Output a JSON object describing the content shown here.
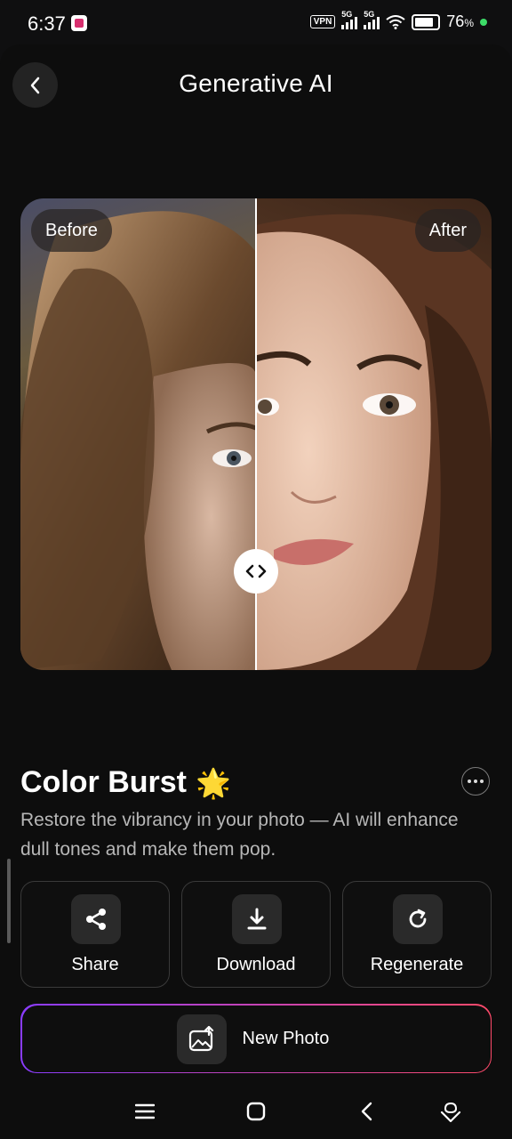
{
  "status_bar": {
    "time": "6:37",
    "vpn": "VPN",
    "network_1": "5G",
    "network_2": "5G",
    "battery_pct": "76",
    "battery_unit": "%"
  },
  "header": {
    "title": "Generative AI",
    "back_icon": "chevron-left-icon"
  },
  "compare": {
    "before_label": "Before",
    "after_label": "After",
    "handle_icon": "compare-arrows-icon"
  },
  "effect": {
    "title": "Color Burst",
    "emoji": "🌟",
    "description": "Restore the vibrancy in your photo — AI will enhance dull tones and make them pop."
  },
  "actions": [
    {
      "label": "Share",
      "icon": "share-icon"
    },
    {
      "label": "Download",
      "icon": "download-icon"
    },
    {
      "label": "Regenerate",
      "icon": "refresh-icon"
    }
  ],
  "new_photo": {
    "label": "New Photo",
    "icon": "image-upload-icon"
  },
  "colors": {
    "background": "#0d0d0d",
    "card_border": "#3a3a3a",
    "gradient_start": "#8a3cff",
    "gradient_end": "#ff4a6a",
    "status_dot": "#3ddc68"
  }
}
